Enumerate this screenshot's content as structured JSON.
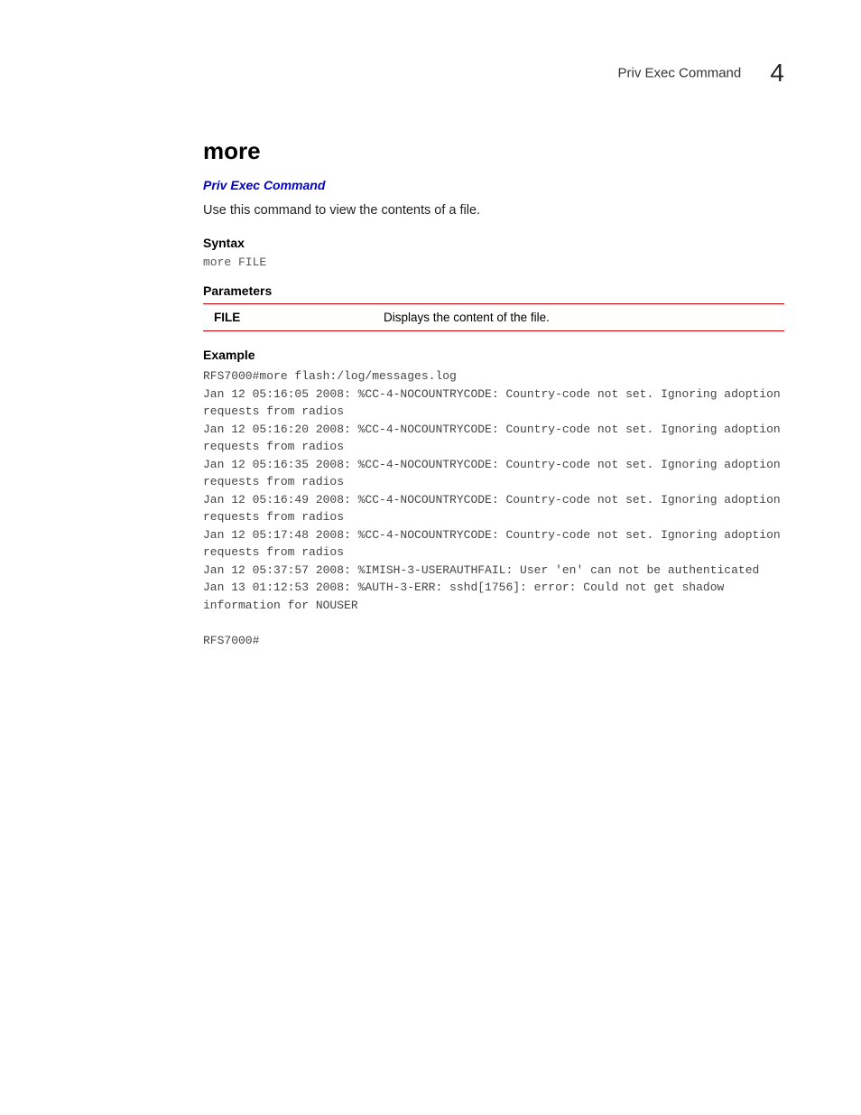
{
  "header": {
    "title": "Priv Exec Command",
    "chapter": "4"
  },
  "command": {
    "name": "more",
    "link": "Priv Exec Command",
    "description": "Use this command to view the contents of a file."
  },
  "syntax": {
    "heading": "Syntax",
    "code": "more FILE"
  },
  "parameters": {
    "heading": "Parameters",
    "rows": [
      {
        "name": "FILE",
        "desc": "Displays the content of the file."
      }
    ]
  },
  "example": {
    "heading": "Example",
    "body": "RFS7000#more flash:/log/messages.log\nJan 12 05:16:05 2008: %CC-4-NOCOUNTRYCODE: Country-code not set. Ignoring adoption requests from radios\nJan 12 05:16:20 2008: %CC-4-NOCOUNTRYCODE: Country-code not set. Ignoring adoption requests from radios\nJan 12 05:16:35 2008: %CC-4-NOCOUNTRYCODE: Country-code not set. Ignoring adoption requests from radios\nJan 12 05:16:49 2008: %CC-4-NOCOUNTRYCODE: Country-code not set. Ignoring adoption requests from radios\nJan 12 05:17:48 2008: %CC-4-NOCOUNTRYCODE: Country-code not set. Ignoring adoption requests from radios\nJan 12 05:37:57 2008: %IMISH-3-USERAUTHFAIL: User 'en' can not be authenticated\nJan 13 01:12:53 2008: %AUTH-3-ERR: sshd[1756]: error: Could not get shadow information for NOUSER\n\nRFS7000#"
  }
}
